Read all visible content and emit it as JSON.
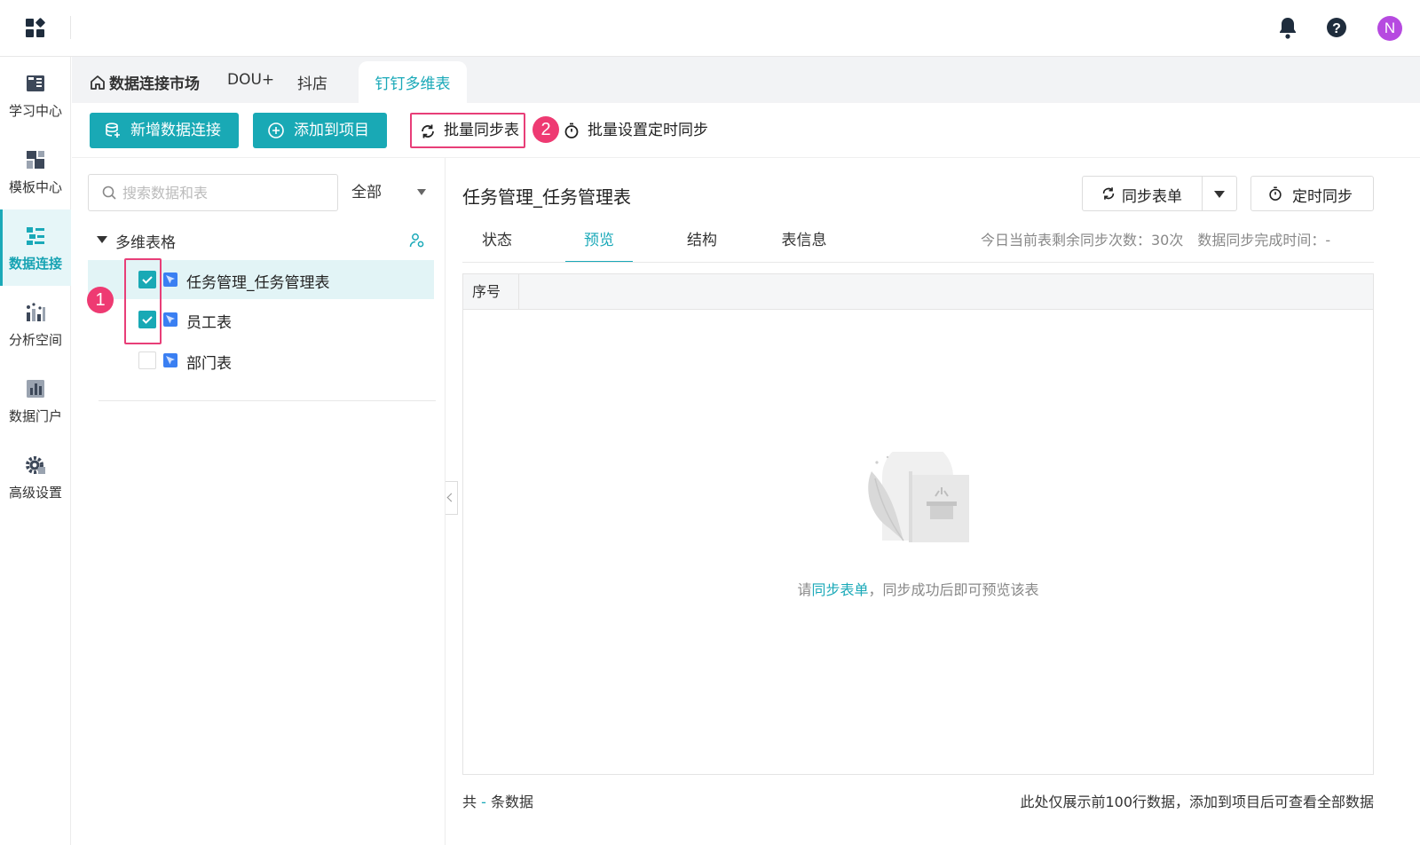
{
  "topbar": {
    "avatar_initial": "N"
  },
  "leftnav": {
    "items": [
      {
        "label": "学习中心",
        "icon": "book-icon"
      },
      {
        "label": "模板中心",
        "icon": "template-icon"
      },
      {
        "label": "数据连接",
        "icon": "data-connection-icon",
        "active": true
      },
      {
        "label": "分析空间",
        "icon": "analysis-icon"
      },
      {
        "label": "数据门户",
        "icon": "bar-chart-icon"
      },
      {
        "label": "高级设置",
        "icon": "gear-icon"
      }
    ]
  },
  "tabs": {
    "home": "数据连接市场",
    "items": [
      "DOU+",
      "抖店"
    ],
    "active": "钉钉多维表"
  },
  "toolbar": {
    "add_connection": "新增数据连接",
    "add_to_project": "添加到项目",
    "batch_sync": "批量同步表",
    "batch_sync_badge": "2",
    "batch_timer": "批量设置定时同步"
  },
  "leftpanel": {
    "search_placeholder": "搜索数据和表",
    "filter": "全部",
    "group_label": "多维表格",
    "items_badge": "1",
    "items": [
      {
        "label": "任务管理_任务管理表",
        "checked": true,
        "selected": true
      },
      {
        "label": "员工表",
        "checked": true,
        "selected": false
      },
      {
        "label": "部门表",
        "checked": false,
        "selected": false
      }
    ]
  },
  "detail": {
    "title": "任务管理_任务管理表",
    "sync_form_button": "同步表单",
    "timer_button": "定时同步",
    "tabs": [
      "状态",
      "预览",
      "结构",
      "表信息"
    ],
    "active_tab": "预览",
    "remaining_syncs": "今日当前表剩余同步次数：30次",
    "sync_complete_time": "数据同步完成时间：-",
    "column_header": "序号",
    "empty_prefix": "请",
    "empty_link": "同步表单",
    "empty_suffix": "，同步成功后即可预览该表",
    "footer_prefix": "共",
    "footer_count": "-",
    "footer_suffix": "条数据",
    "footer_note": "此处仅展示前100行数据，添加到项目后可查看全部数据"
  },
  "colors": {
    "accent": "#1aa9b8",
    "highlight": "#e83e78",
    "avatar": "#b64ae0"
  }
}
